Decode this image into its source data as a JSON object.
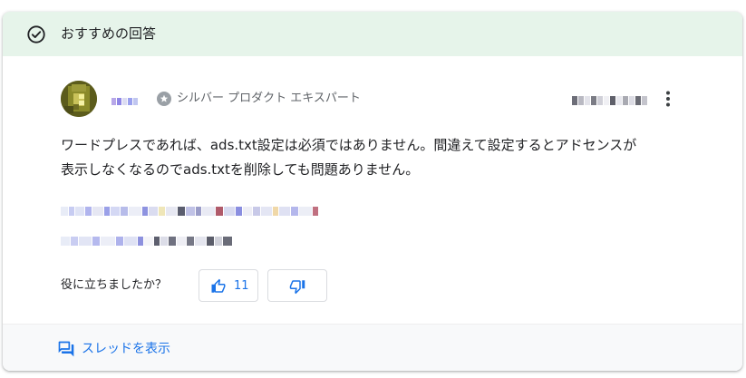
{
  "header": {
    "title": "おすすめの回答",
    "icon": "check-circle-icon"
  },
  "author": {
    "avatar_icon": "avatar",
    "badge_icon": "star-badge-icon",
    "badge_label": "シルバー プロダクト エキスパート",
    "more_icon": "more-vert-icon"
  },
  "answer": {
    "line1": "ワードプレスであれば、ads.txt設定は必須ではありません。間違えて設定するとアドセンスが",
    "line2": "表示しなくなるのでads.txtを削除しても問題ありません。"
  },
  "feedback": {
    "question": "役に立ちましたか？",
    "upvote_count": "11",
    "upvote_icon": "thumb-up-icon",
    "downvote_icon": "thumb-down-icon"
  },
  "footer": {
    "link_label": "スレッドを表示",
    "link_icon": "forum-icon"
  },
  "colors": {
    "header_bg": "#e6f4ea",
    "link": "#1a73e8",
    "text": "#202124",
    "muted": "#5f6368"
  }
}
